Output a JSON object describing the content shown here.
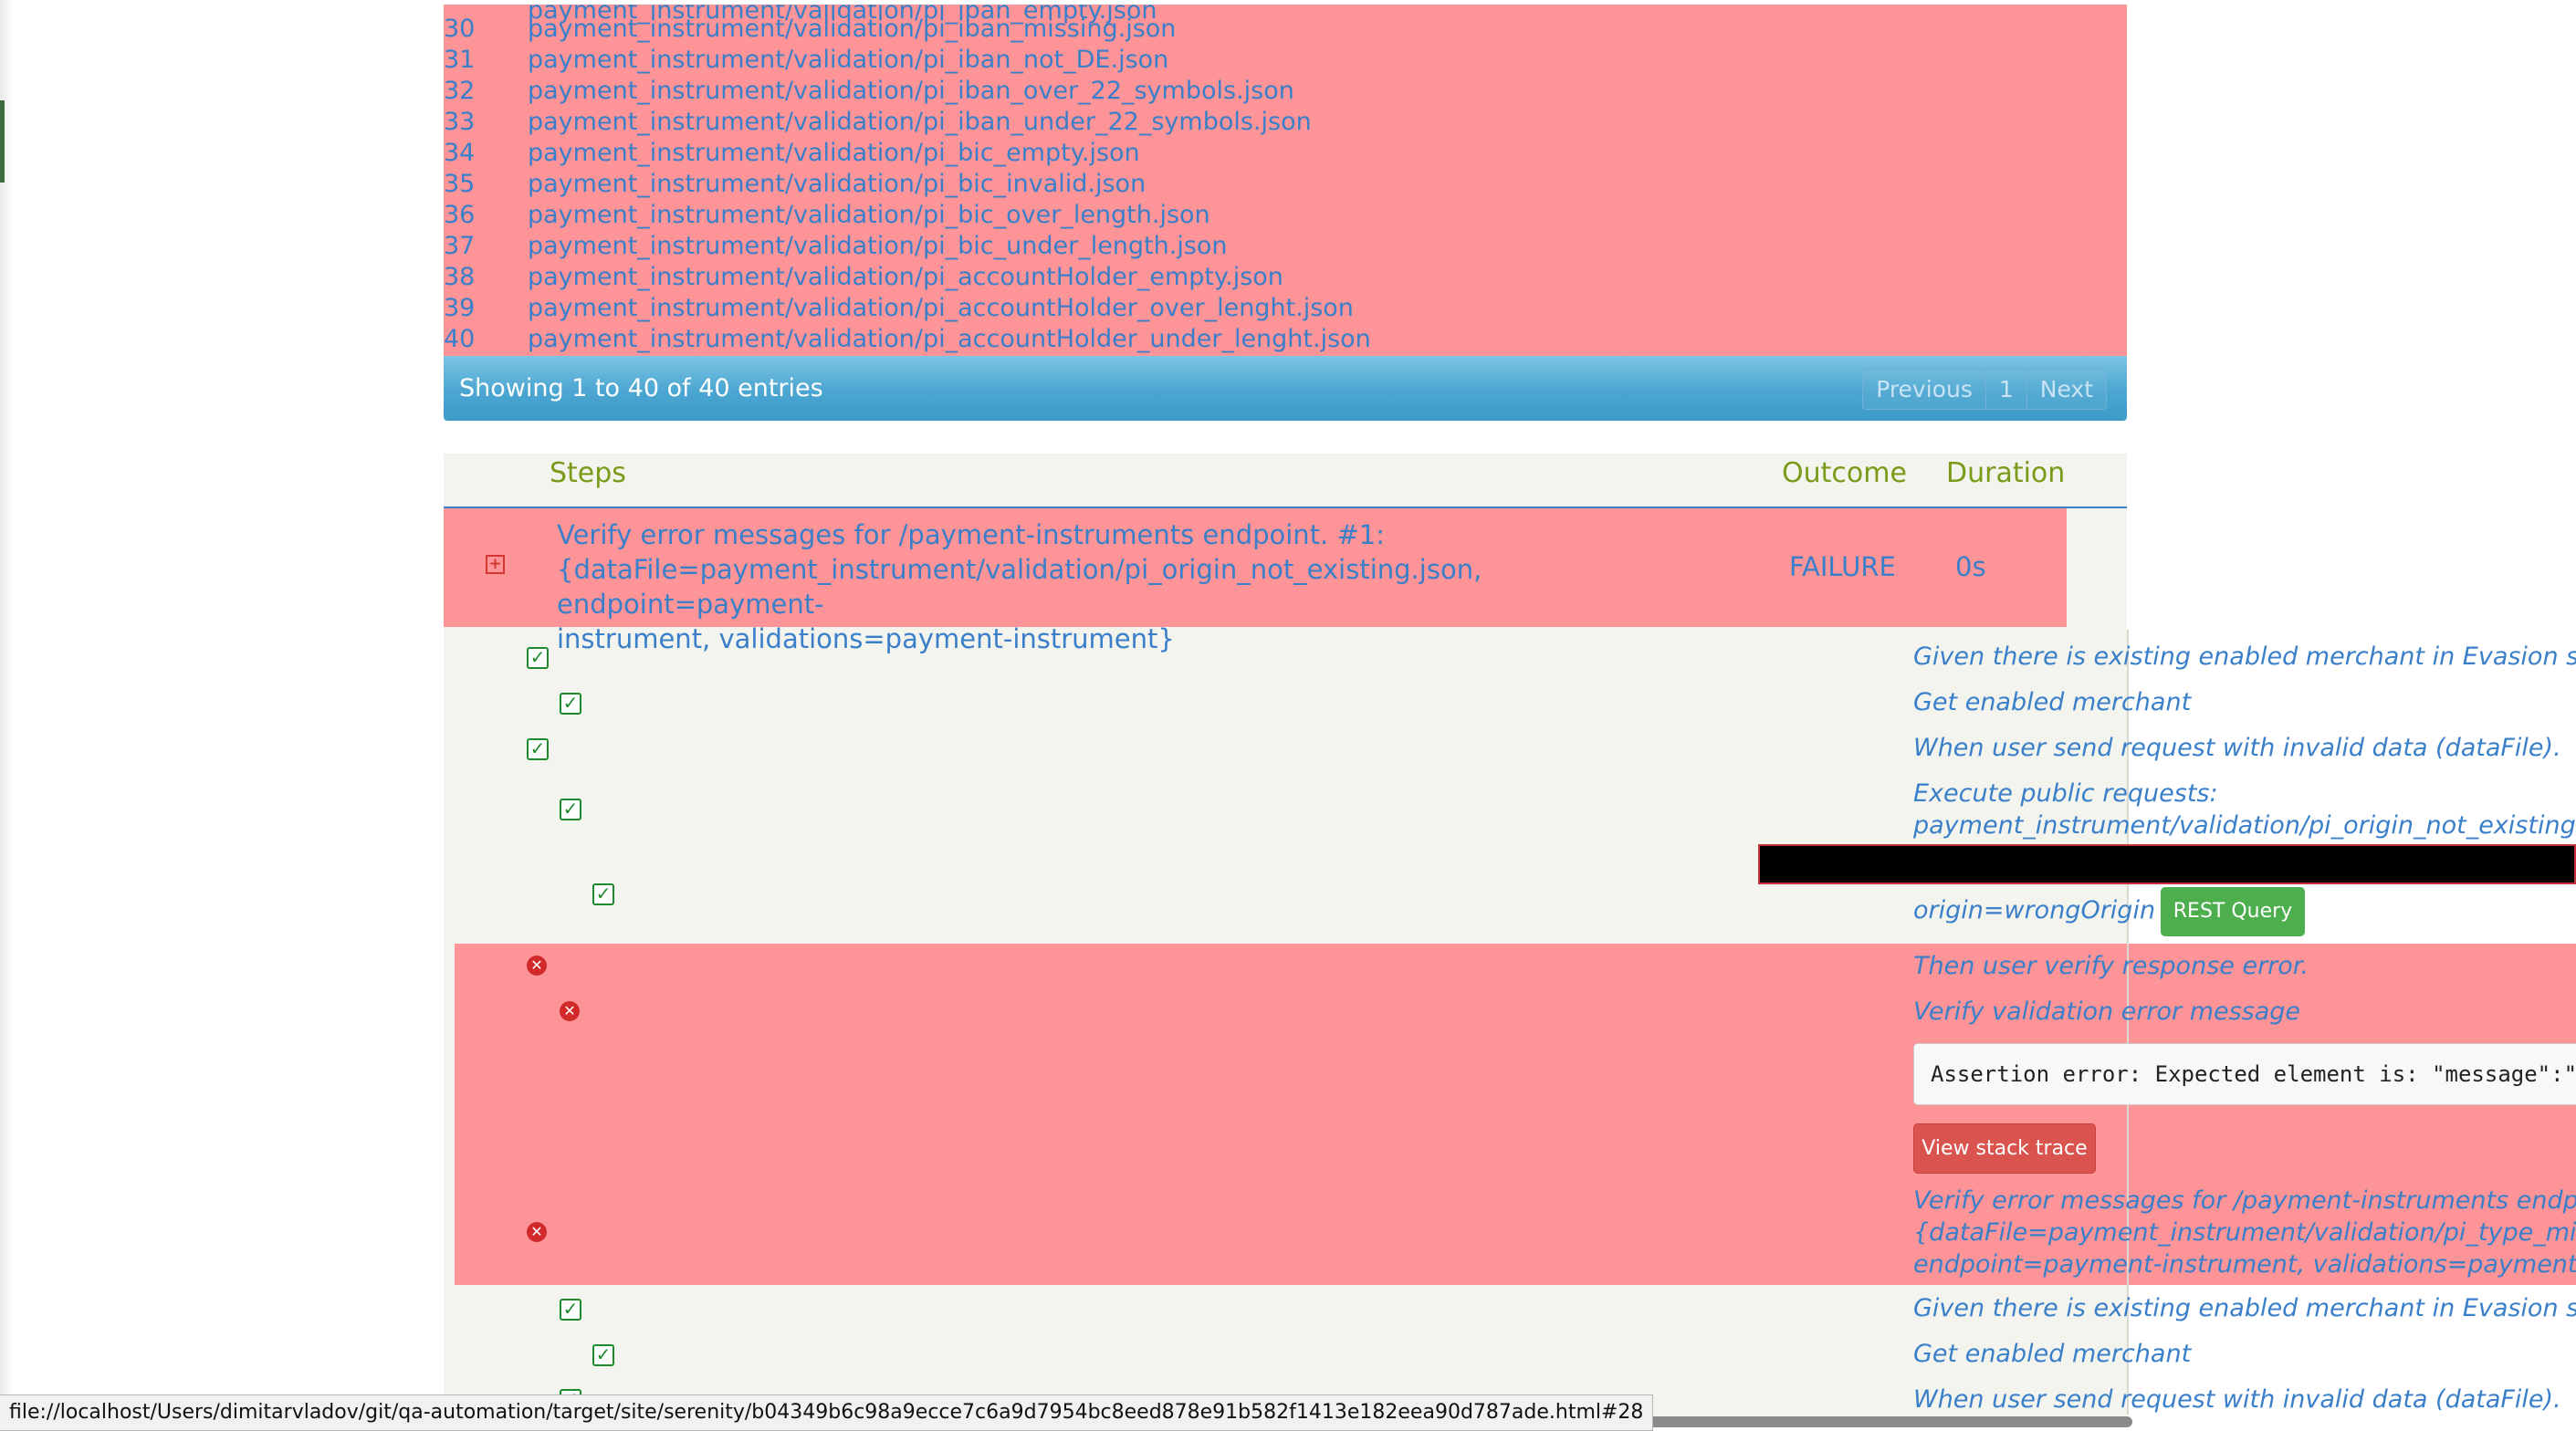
{
  "data_table": {
    "rows": [
      {
        "num": "30",
        "file": "payment_instrument/validation/pi_iban_missing.json"
      },
      {
        "num": "31",
        "file": "payment_instrument/validation/pi_iban_not_DE.json"
      },
      {
        "num": "32",
        "file": "payment_instrument/validation/pi_iban_over_22_symbols.json"
      },
      {
        "num": "33",
        "file": "payment_instrument/validation/pi_iban_under_22_symbols.json"
      },
      {
        "num": "34",
        "file": "payment_instrument/validation/pi_bic_empty.json"
      },
      {
        "num": "35",
        "file": "payment_instrument/validation/pi_bic_invalid.json"
      },
      {
        "num": "36",
        "file": "payment_instrument/validation/pi_bic_over_length.json"
      },
      {
        "num": "37",
        "file": "payment_instrument/validation/pi_bic_under_length.json"
      },
      {
        "num": "38",
        "file": "payment_instrument/validation/pi_accountHolder_empty.json"
      },
      {
        "num": "39",
        "file": "payment_instrument/validation/pi_accountHolder_over_lenght.json"
      },
      {
        "num": "40",
        "file": "payment_instrument/validation/pi_accountHolder_under_lenght.json"
      }
    ],
    "footer_info": "Showing 1 to 40 of 40 entries",
    "pager": {
      "previous": "Previous",
      "page": "1",
      "next": "Next"
    }
  },
  "steps_table": {
    "headers": {
      "steps": "Steps",
      "outcome": "Outcome",
      "duration": "Duration"
    },
    "scenario": {
      "title_line1": "Verify error messages for /payment-instruments endpoint. #1:",
      "title_line2": "{dataFile=payment_instrument/validation/pi_origin_not_existing.json, endpoint=payment-",
      "title_line3": "instrument, validations=payment-instrument}",
      "outcome": "FAILURE",
      "duration": "0s"
    },
    "steps": [
      {
        "status": "success",
        "text": "Given there is existing enabled merchant in Evasion serv"
      },
      {
        "status": "success",
        "text": "Get enabled merchant"
      },
      {
        "status": "success",
        "text": "When user send request with invalid data (dataFile)."
      },
      {
        "status": "success",
        "text_line1": "Execute public requests:",
        "text_line2": "payment_instrument/validation/pi_origin_not_existing.js"
      },
      {
        "status": "success",
        "text": "origin=wrongOrigin",
        "button": "REST Query"
      },
      {
        "status": "failure",
        "text": "Then user verify response error."
      },
      {
        "status": "failure",
        "text": "Verify validation error message"
      },
      {
        "status": "failure",
        "line1": "Verify error messages for /payment-instruments endpoin",
        "line2": "{dataFile=payment_instrument/validation/pi_type_missi",
        "line3": "endpoint=payment-instrument, validations=payment-ins"
      },
      {
        "status": "success",
        "text": "Given there is existing enabled merchant in Evasion serv"
      },
      {
        "status": "success",
        "text": "Get enabled merchant"
      },
      {
        "status": "success",
        "text": "When user send request with invalid data (dataFile)."
      }
    ],
    "assertion_text": "Assertion error: Expected element is: \"message\":\"E",
    "stack_trace_button": "View stack trace"
  },
  "status_bar": {
    "url": "file://localhost/Users/dimitarvladov/git/qa-automation/target/site/serenity/b04349b6c98a9ecce7c6a9d7954bc8eed878e91b582f1413e182eea90d787ade.html#28"
  },
  "colors": {
    "failure_row": "#fd9497",
    "link_blue": "#3a7fc9",
    "header_green": "#7a9a1a",
    "success_green": "#1e8a2e",
    "error_red": "#d22a2a",
    "rest_button": "#4cae4c",
    "stack_button": "#d9534f"
  }
}
